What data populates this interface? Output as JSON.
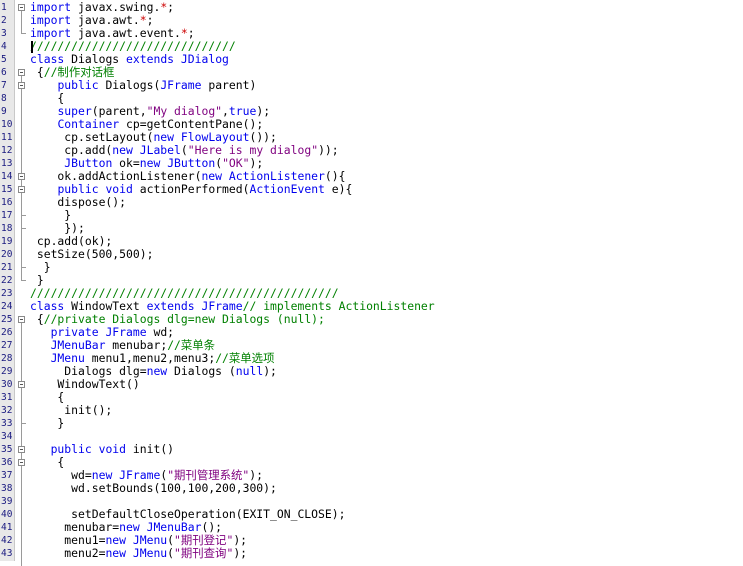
{
  "editor": {
    "colors": {
      "keyword": "#0000ee",
      "string": "#7f007f",
      "comment": "#008000",
      "star": "#cc0000",
      "line_numbers": "#1a1a80",
      "gutter": "#e8e8e8"
    },
    "lines": [
      {
        "n": "1",
        "indent": 0,
        "segs": [
          [
            "k",
            "import"
          ],
          [
            "n",
            " javax.swing."
          ],
          [
            "st",
            "*"
          ],
          [
            "n",
            ";"
          ]
        ]
      },
      {
        "n": "2",
        "indent": 0,
        "segs": [
          [
            "k",
            "import"
          ],
          [
            "n",
            " java.awt."
          ],
          [
            "st",
            "*"
          ],
          [
            "n",
            ";"
          ]
        ]
      },
      {
        "n": "3",
        "indent": 0,
        "segs": [
          [
            "k",
            "import"
          ],
          [
            "n",
            " java.awt.event."
          ],
          [
            "st",
            "*"
          ],
          [
            "n",
            ";"
          ]
        ]
      },
      {
        "n": "4",
        "indent": 0,
        "segs": [
          [
            "c",
            "//////////////////////////////"
          ]
        ]
      },
      {
        "n": "5",
        "indent": 0,
        "segs": [
          [
            "k",
            "class"
          ],
          [
            "n",
            " Dialogs "
          ],
          [
            "k",
            "extends"
          ],
          [
            "n",
            " "
          ],
          [
            "k",
            "JDialog"
          ]
        ]
      },
      {
        "n": "6",
        "indent": 0,
        "segs": [
          [
            "n",
            " {"
          ],
          [
            "c",
            "//制作对话框"
          ]
        ]
      },
      {
        "n": "7",
        "indent": 0,
        "segs": [
          [
            "n",
            "    "
          ],
          [
            "k",
            "public"
          ],
          [
            "n",
            " Dialogs("
          ],
          [
            "k",
            "JFrame"
          ],
          [
            "n",
            " parent)"
          ]
        ]
      },
      {
        "n": "8",
        "indent": 0,
        "segs": [
          [
            "n",
            "    {"
          ]
        ]
      },
      {
        "n": "9",
        "indent": 0,
        "segs": [
          [
            "n",
            "    "
          ],
          [
            "k",
            "super"
          ],
          [
            "n",
            "(parent,"
          ],
          [
            "s",
            "\"My dialog\""
          ],
          [
            "n",
            ","
          ],
          [
            "k",
            "true"
          ],
          [
            "n",
            ");"
          ]
        ]
      },
      {
        "n": "10",
        "indent": 0,
        "segs": [
          [
            "n",
            "    "
          ],
          [
            "k",
            "Container"
          ],
          [
            "n",
            " cp=getContentPane();"
          ]
        ]
      },
      {
        "n": "11",
        "indent": 0,
        "segs": [
          [
            "n",
            "     cp.setLayout("
          ],
          [
            "k",
            "new"
          ],
          [
            "n",
            " "
          ],
          [
            "k",
            "FlowLayout"
          ],
          [
            "n",
            "());"
          ]
        ]
      },
      {
        "n": "12",
        "indent": 0,
        "segs": [
          [
            "n",
            "     cp.add("
          ],
          [
            "k",
            "new"
          ],
          [
            "n",
            " "
          ],
          [
            "k",
            "JLabel"
          ],
          [
            "n",
            "("
          ],
          [
            "s",
            "\"Here is my dialog\""
          ],
          [
            "n",
            "));"
          ]
        ]
      },
      {
        "n": "13",
        "indent": 0,
        "segs": [
          [
            "n",
            "     "
          ],
          [
            "k",
            "JButton"
          ],
          [
            "n",
            " ok="
          ],
          [
            "k",
            "new"
          ],
          [
            "n",
            " "
          ],
          [
            "k",
            "JButton"
          ],
          [
            "n",
            "("
          ],
          [
            "s",
            "\"OK\""
          ],
          [
            "n",
            ");"
          ]
        ]
      },
      {
        "n": "14",
        "indent": 0,
        "segs": [
          [
            "n",
            "    ok.addActionListener("
          ],
          [
            "k",
            "new"
          ],
          [
            "n",
            " "
          ],
          [
            "k",
            "ActionListener"
          ],
          [
            "n",
            "(){"
          ]
        ]
      },
      {
        "n": "15",
        "indent": 0,
        "segs": [
          [
            "n",
            "    "
          ],
          [
            "k",
            "public"
          ],
          [
            "n",
            " "
          ],
          [
            "k",
            "void"
          ],
          [
            "n",
            " actionPerformed("
          ],
          [
            "k",
            "ActionEvent"
          ],
          [
            "n",
            " e){"
          ]
        ]
      },
      {
        "n": "16",
        "indent": 0,
        "segs": [
          [
            "n",
            "    dispose();"
          ]
        ]
      },
      {
        "n": "17",
        "indent": 0,
        "segs": [
          [
            "n",
            "     }"
          ]
        ]
      },
      {
        "n": "18",
        "indent": 0,
        "segs": [
          [
            "n",
            "     });"
          ]
        ]
      },
      {
        "n": "19",
        "indent": 0,
        "segs": [
          [
            "n",
            " cp.add(ok);"
          ]
        ]
      },
      {
        "n": "20",
        "indent": 0,
        "segs": [
          [
            "n",
            " setSize(500,500);"
          ]
        ]
      },
      {
        "n": "21",
        "indent": 0,
        "segs": [
          [
            "n",
            "  }"
          ]
        ]
      },
      {
        "n": "22",
        "indent": 0,
        "segs": [
          [
            "n",
            " }"
          ]
        ]
      },
      {
        "n": "23",
        "indent": 0,
        "segs": [
          [
            "c",
            "/////////////////////////////////////////////"
          ]
        ]
      },
      {
        "n": "24",
        "indent": 0,
        "segs": [
          [
            "k",
            "class"
          ],
          [
            "n",
            " WindowText "
          ],
          [
            "k",
            "extends"
          ],
          [
            "n",
            " "
          ],
          [
            "k",
            "JFrame"
          ],
          [
            "c",
            "// implements ActionListener"
          ]
        ]
      },
      {
        "n": "25",
        "indent": 0,
        "segs": [
          [
            "n",
            " {"
          ],
          [
            "c",
            "//private Dialogs dlg=new Dialogs (null);"
          ]
        ]
      },
      {
        "n": "26",
        "indent": 0,
        "segs": [
          [
            "n",
            "   "
          ],
          [
            "k",
            "private"
          ],
          [
            "n",
            " "
          ],
          [
            "k",
            "JFrame"
          ],
          [
            "n",
            " wd;"
          ]
        ]
      },
      {
        "n": "27",
        "indent": 0,
        "segs": [
          [
            "n",
            "   "
          ],
          [
            "k",
            "JMenuBar"
          ],
          [
            "n",
            " menubar;"
          ],
          [
            "c",
            "//菜单条"
          ]
        ]
      },
      {
        "n": "28",
        "indent": 0,
        "segs": [
          [
            "n",
            "   "
          ],
          [
            "k",
            "JMenu"
          ],
          [
            "n",
            " menu1,menu2,menu3;"
          ],
          [
            "c",
            "//菜单选项"
          ]
        ]
      },
      {
        "n": "29",
        "indent": 0,
        "segs": [
          [
            "n",
            "     Dialogs dlg="
          ],
          [
            "k",
            "new"
          ],
          [
            "n",
            " Dialogs ("
          ],
          [
            "k",
            "null"
          ],
          [
            "n",
            ");"
          ]
        ]
      },
      {
        "n": "30",
        "indent": 0,
        "segs": [
          [
            "n",
            "    WindowText()"
          ]
        ]
      },
      {
        "n": "31",
        "indent": 0,
        "segs": [
          [
            "n",
            "    {"
          ]
        ]
      },
      {
        "n": "32",
        "indent": 0,
        "segs": [
          [
            "n",
            "     init();"
          ]
        ]
      },
      {
        "n": "33",
        "indent": 0,
        "segs": [
          [
            "n",
            "    }"
          ]
        ]
      },
      {
        "n": "34",
        "indent": 0,
        "segs": [
          [
            "n",
            ""
          ]
        ]
      },
      {
        "n": "35",
        "indent": 0,
        "segs": [
          [
            "n",
            "   "
          ],
          [
            "k",
            "public"
          ],
          [
            "n",
            " "
          ],
          [
            "k",
            "void"
          ],
          [
            "n",
            " init()"
          ]
        ]
      },
      {
        "n": "36",
        "indent": 0,
        "segs": [
          [
            "n",
            "    {"
          ]
        ]
      },
      {
        "n": "37",
        "indent": 0,
        "segs": [
          [
            "n",
            "      wd="
          ],
          [
            "k",
            "new"
          ],
          [
            "n",
            " "
          ],
          [
            "k",
            "JFrame"
          ],
          [
            "n",
            "("
          ],
          [
            "s",
            "\"期刊管理系统\""
          ],
          [
            "n",
            ");"
          ]
        ]
      },
      {
        "n": "38",
        "indent": 0,
        "segs": [
          [
            "n",
            "      wd.setBounds(100,100,200,300);"
          ]
        ]
      },
      {
        "n": "39",
        "indent": 0,
        "segs": [
          [
            "n",
            ""
          ]
        ]
      },
      {
        "n": "40",
        "indent": 0,
        "segs": [
          [
            "n",
            "      setDefaultCloseOperation(EXIT_ON_CLOSE);"
          ]
        ]
      },
      {
        "n": "41",
        "indent": 0,
        "segs": [
          [
            "n",
            "     menubar="
          ],
          [
            "k",
            "new"
          ],
          [
            "n",
            " "
          ],
          [
            "k",
            "JMenuBar"
          ],
          [
            "n",
            "();"
          ]
        ]
      },
      {
        "n": "42",
        "indent": 0,
        "segs": [
          [
            "n",
            "     menu1="
          ],
          [
            "k",
            "new"
          ],
          [
            "n",
            " "
          ],
          [
            "k",
            "JMenu"
          ],
          [
            "n",
            "("
          ],
          [
            "s",
            "\"期刊登记\""
          ],
          [
            "n",
            ");"
          ]
        ]
      },
      {
        "n": "43",
        "indent": 0,
        "segs": [
          [
            "n",
            "     menu2="
          ],
          [
            "k",
            "new"
          ],
          [
            "n",
            " "
          ],
          [
            "k",
            "JMenu"
          ],
          [
            "n",
            "("
          ],
          [
            "s",
            "\"期刊查询\""
          ],
          [
            "n",
            ");"
          ]
        ]
      }
    ]
  }
}
